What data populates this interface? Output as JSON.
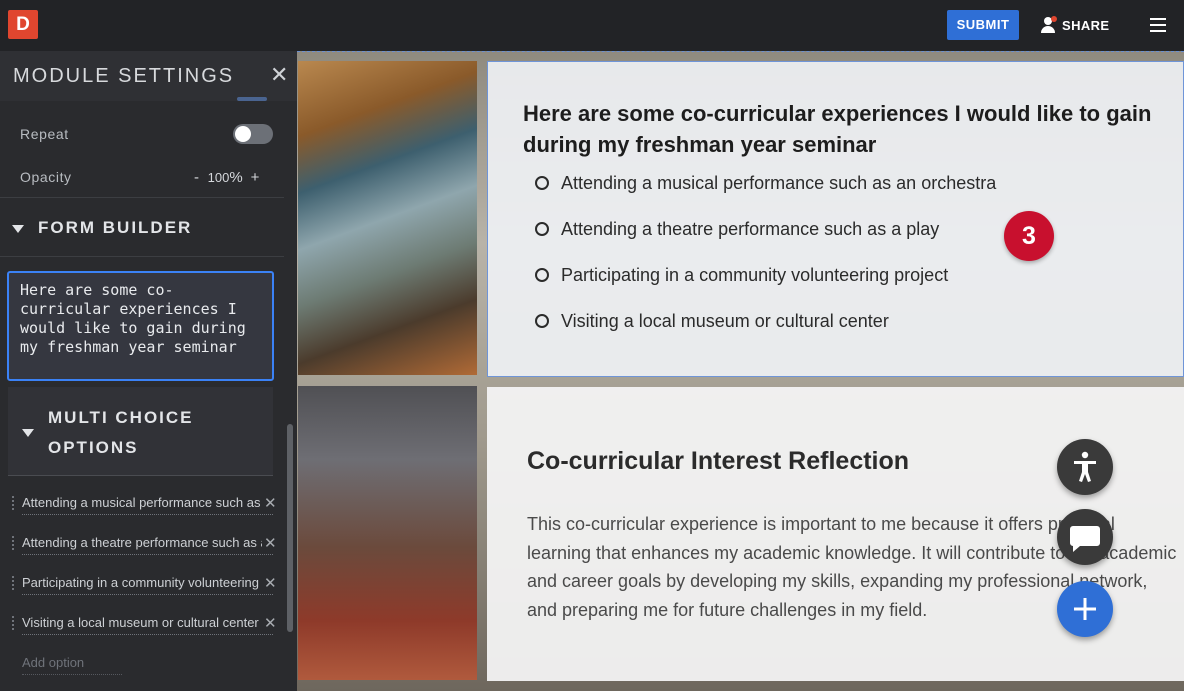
{
  "app": {
    "logo_letter": "D"
  },
  "topbar": {
    "submit_label": "SUBMIT",
    "share_label": "SHARE"
  },
  "sidebar": {
    "title": "MODULE SETTINGS",
    "repeat_label": "Repeat",
    "opacity_label": "Opacity",
    "opacity_minus": "-",
    "opacity_value": "100",
    "opacity_unit": "%",
    "opacity_plus": "+",
    "form_builder_label": "FORM BUILDER",
    "question_text": "Here are some co-curricular experiences I would like to gain during my freshman year seminar",
    "multi_choice_label": "MULTI CHOICE OPTIONS",
    "options": [
      "Attending a musical performance such as an orchestra",
      "Attending a theatre performance such as a play",
      "Participating in a community volunteering project",
      "Visiting a local museum or cultural center"
    ],
    "add_option_placeholder": "Add option"
  },
  "canvas": {
    "question": {
      "title": "Here are some co-curricular experiences I would like to gain during my freshman year seminar",
      "choices": [
        "Attending a musical performance such as an orchestra",
        "Attending a theatre performance such as a play",
        "Participating in a community volunteering project",
        "Visiting a local museum or cultural center"
      ]
    },
    "badge_number": "3",
    "reflection": {
      "title": "Co-curricular Interest Reflection",
      "body": "This co-curricular experience is important to me because it offers practical learning that enhances my academic knowledge. It will contribute to my academic and career goals by developing my skills, expanding my professional network, and preparing me for future challenges in my field."
    }
  },
  "colors": {
    "accent": "#2f6fd6",
    "logo": "#e0462f",
    "badge": "#c8102e"
  },
  "icons": [
    "person-icon",
    "menu-icon",
    "close-icon",
    "caret-down-icon",
    "accessibility-icon",
    "chat-icon",
    "plus-icon"
  ]
}
